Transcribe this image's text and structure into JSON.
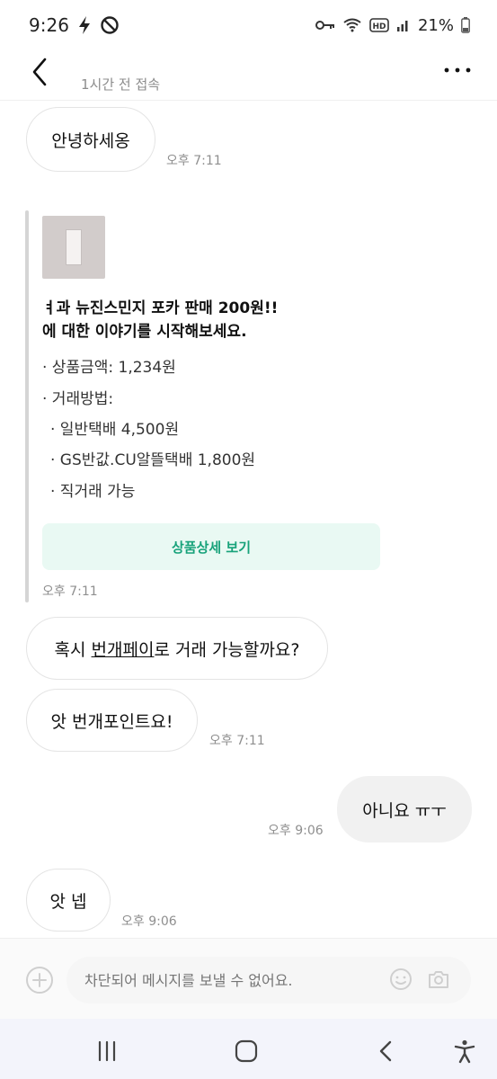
{
  "status_bar": {
    "time": "9:26",
    "battery": "21%",
    "icons": [
      "flash-icon",
      "do-not-disturb-icon",
      "key-icon",
      "wifi-icon",
      "hd-icon",
      "signal-icon",
      "battery-icon"
    ]
  },
  "header": {
    "last_seen": "1시간 전 접속",
    "icons": [
      "back-icon",
      "more-icon"
    ]
  },
  "messages": {
    "m1": {
      "text": "안녕하세옹",
      "time": "오후 7:11"
    },
    "m3": {
      "text_prefix": "혹시 ",
      "text_link": "번개페이",
      "text_suffix": "로 거래 가능할까요?"
    },
    "m4": {
      "text": "앗 번개포인트요!",
      "time": "오후 7:11"
    },
    "m5": {
      "text": "아니요 ㅠㅜ",
      "time": "오후 9:06"
    },
    "m6": {
      "text": "앗 넵",
      "time": "오후 9:06"
    }
  },
  "product_card": {
    "title_line1": "ㅕ과 뉴진스민지 포카 판매 200원!!",
    "title_line2": "에 대한 이야기를 시작해보세요.",
    "price": "· 상품금액: 1,234원",
    "method_label": "· 거래방법:",
    "methods": [
      "· 일반택배 4,500원",
      "· GS반값.CU알뜰택배 1,800원",
      "· 직거래 가능"
    ],
    "detail_button": "상품상세 보기",
    "time": "오후 7:11"
  },
  "input": {
    "placeholder": "차단되어 메시지를 보낼 수 없어요."
  },
  "colors": {
    "accent_green": "#17a27a",
    "detail_button_bg": "#e9f9f3",
    "my_bubble_bg": "#f1f1f1"
  }
}
